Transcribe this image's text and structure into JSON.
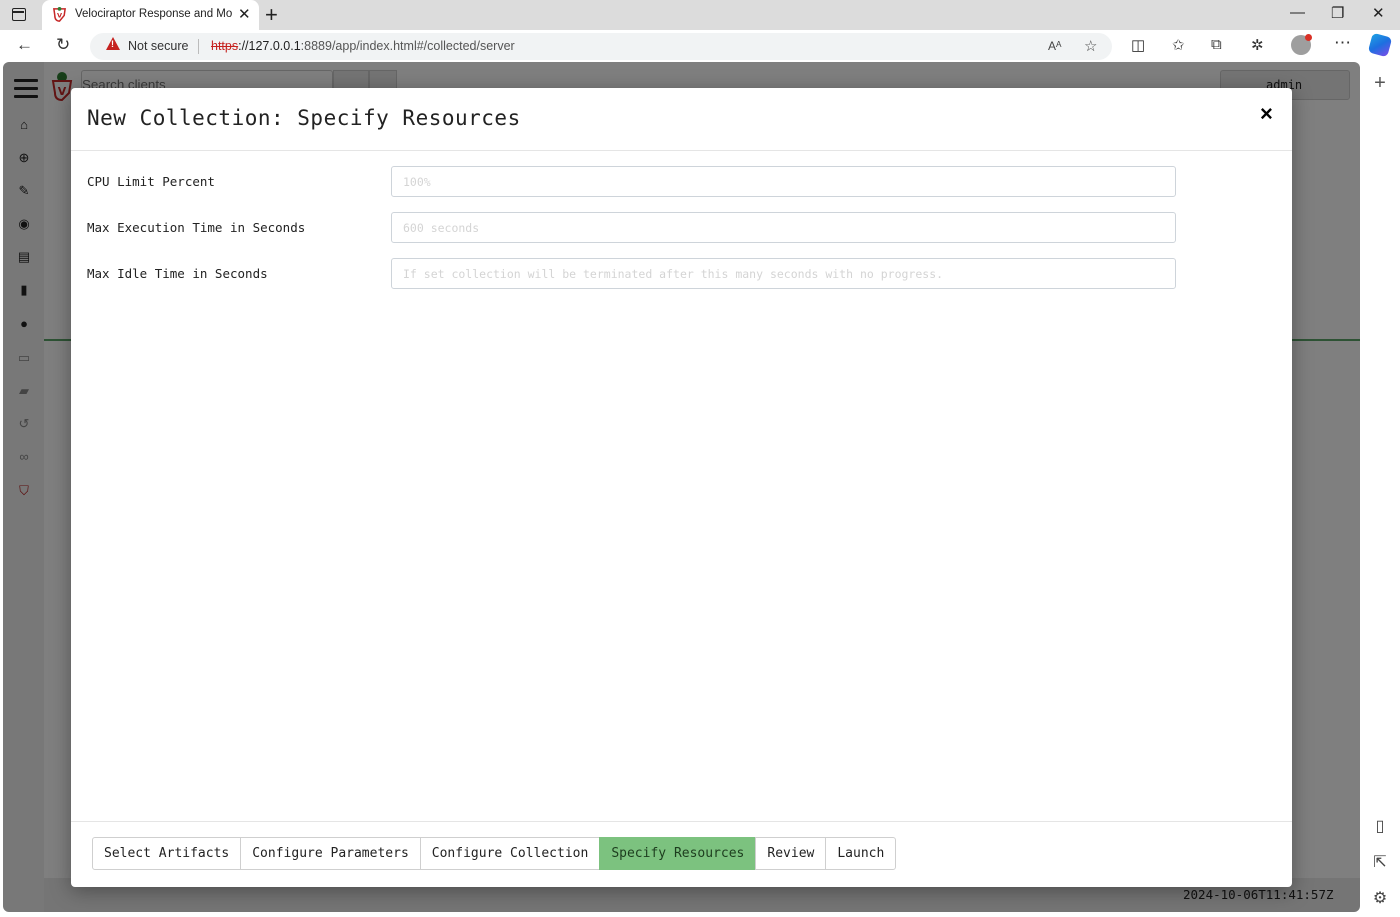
{
  "browser": {
    "tab_title": "Velociraptor Response and Moni",
    "url_scheme": "https",
    "url_host": "://127.0.0.1",
    "url_rest": ":8889/app/index.html#/collected/server",
    "security_label": "Not secure"
  },
  "app": {
    "search_placeholder": "Search clients",
    "username": "admin",
    "timestamp": "2024-10-06T11:41:57Z"
  },
  "modal": {
    "title": "New Collection: Specify Resources",
    "close_label": "×",
    "fields": [
      {
        "label": "CPU Limit Percent",
        "placeholder": "100%",
        "value": ""
      },
      {
        "label": "Max Execution Time in Seconds",
        "placeholder": "600 seconds",
        "value": ""
      },
      {
        "label": "Max Idle Time in Seconds",
        "placeholder": "If set collection will be terminated after this many seconds with no progress.",
        "value": ""
      }
    ],
    "steps": [
      {
        "label": "Select Artifacts",
        "active": false
      },
      {
        "label": "Configure Parameters",
        "active": false
      },
      {
        "label": "Configure Collection",
        "active": false
      },
      {
        "label": "Specify Resources",
        "active": true
      },
      {
        "label": "Review",
        "active": false
      },
      {
        "label": "Launch",
        "active": false
      }
    ]
  },
  "colors": {
    "active_step": "#7cc27f",
    "accent_green": "#5aa469",
    "insecure_red": "#c5221f"
  }
}
